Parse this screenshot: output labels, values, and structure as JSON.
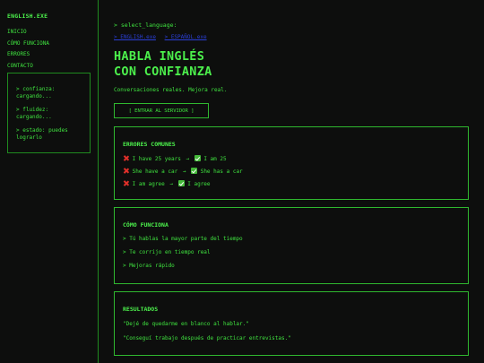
{
  "sidebar": {
    "logo": "ENGLISH.EXE",
    "nav": [
      "INICIO",
      "CÓMO FUNCIONA",
      "ERRORES",
      "CONTACTO"
    ],
    "status": [
      "> confianza: cargando...",
      "> fluidez: cargando...",
      "> estado: puedes lograrlo"
    ]
  },
  "main": {
    "prompt": "> select_language:",
    "languages": [
      "> ENGLISH.exe",
      "> ESPAÑOL.exe"
    ],
    "hero_title_line1": "HABLA INGLÉS",
    "hero_title_line2": "CON CONFIANZA",
    "hero_subtitle": "Conversaciones reales. Mejora real.",
    "cta_label": "[ ENTRAR AL SERVIDOR ]"
  },
  "errors_card": {
    "title": "ERRORES COMUNES",
    "arrow": "→",
    "items": [
      {
        "wrong": "I have 25 years",
        "right": "I am 25"
      },
      {
        "wrong": "She have a car",
        "right": "She has a car"
      },
      {
        "wrong": "I am agree",
        "right": "I agree"
      }
    ]
  },
  "how_card": {
    "title": "CÓMO FUNCIONA",
    "items": [
      "> Tú hablas la mayor parte del tiempo",
      "> Te corrijo en tiempo real",
      "> Mejoras rápido"
    ]
  },
  "results_card": {
    "title": "RESULTADOS",
    "items": [
      "\"Dejé de quedarme en blanco al hablar.\"",
      "\"Conseguí trabajo después de practicar entrevistas.\""
    ]
  },
  "colors": {
    "background": "#0d0e0d",
    "accent_green": "#3fe33f",
    "border_green": "#2fb82f",
    "link_blue": "#2a3fd6",
    "error_red": "#e0302a",
    "check_green": "#45b93a"
  }
}
